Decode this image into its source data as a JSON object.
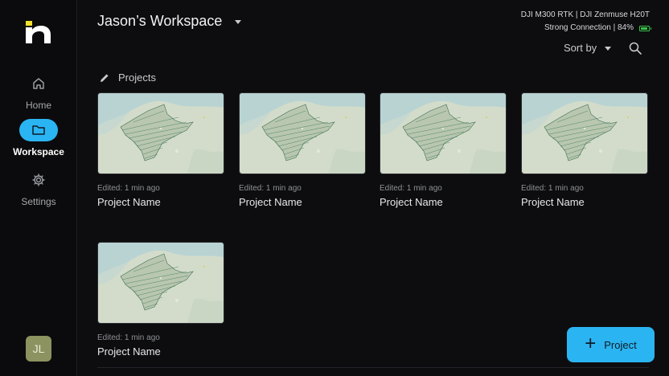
{
  "workspace": {
    "title": "Jason’s Workspace"
  },
  "device": {
    "model_line": "DJI M300 RTK | DJI Zenmuse H20T",
    "connection_line": "Strong Connection | 84%",
    "battery_percent": 84,
    "battery_color": "#3ac24a"
  },
  "nav": {
    "home_label": "Home",
    "workspace_label": "Workspace",
    "settings_label": "Settings",
    "active": "Workspace"
  },
  "user": {
    "initials": "JL"
  },
  "toolbar": {
    "sort_label": "Sort by"
  },
  "projects_section": {
    "title": "Projects"
  },
  "projects": [
    {
      "edited": "Edited: 1 min ago",
      "name": "Project Name"
    },
    {
      "edited": "Edited: 1 min ago",
      "name": "Project Name"
    },
    {
      "edited": "Edited: 1 min ago",
      "name": "Project Name"
    },
    {
      "edited": "Edited: 1 min ago",
      "name": "Project Name"
    },
    {
      "edited": "Edited: 1 min ago",
      "name": "Project Name"
    }
  ],
  "fab": {
    "label": "Project"
  },
  "colors": {
    "accent": "#2bb4f2",
    "background": "#0d0d0f",
    "avatar": "#8c9260"
  },
  "icons": [
    "logo-icon",
    "home-icon",
    "folder-icon",
    "gear-icon",
    "chevron-down-icon",
    "search-icon",
    "pencil-icon",
    "plus-icon",
    "battery-icon"
  ]
}
